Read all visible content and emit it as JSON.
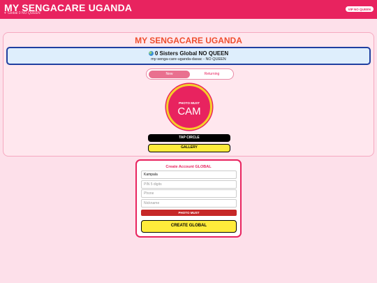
{
  "header": {
    "title": "MY SENGACARE UGANDA",
    "subtitle": "Global 0 NO QUEEN",
    "vip_label": "VIP NO QUEEN"
  },
  "card": {
    "title": "MY SENGACARE UGANDA",
    "status_main": "0 Sisters Global NO QUEEN",
    "status_sub": "my-senga-care-uganda-dasac - NO QUEEN"
  },
  "tabs": {
    "active": "New",
    "inactive": "Returning"
  },
  "photo": {
    "small_label": "PHOTO MUST",
    "big_label": "CAM"
  },
  "buttons": {
    "tap_circle": "TAP CIRCLE",
    "gallery": "GALLERY"
  },
  "form": {
    "title": "Create Account GLOBAL",
    "location_value": "Kampala",
    "pin_placeholder": "PIN 5 digits",
    "phone_placeholder": "Phone",
    "nickname_placeholder": "Nickname",
    "photo_must": "PHOTO MUST",
    "create_label": "CREATE GLOBAL"
  },
  "colors": {
    "brand": "#e8235f",
    "accent_yellow": "#ffeb3b",
    "status_border": "#1f3fa0"
  }
}
